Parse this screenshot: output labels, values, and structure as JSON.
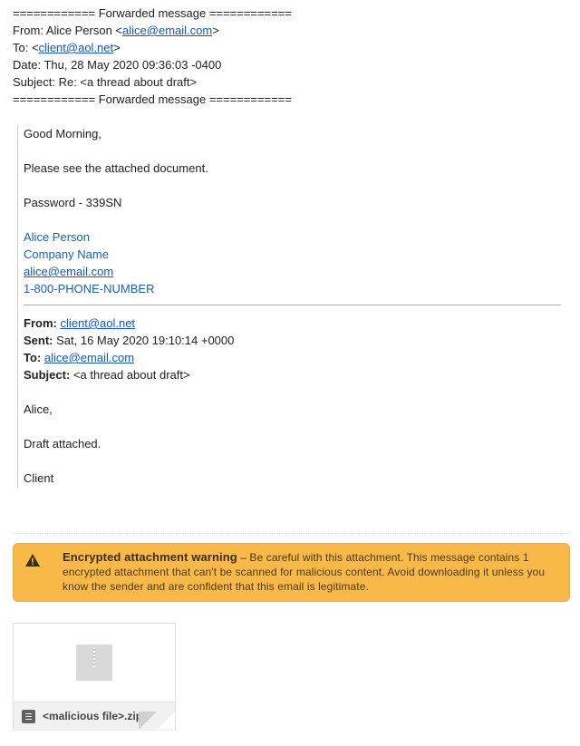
{
  "forwarded_header": {
    "separator": "============ Forwarded message ============",
    "from_prefix": "From: Alice Person <",
    "from_email": "alice@email.com",
    "from_suffix": ">",
    "to_prefix": "To: <",
    "to_email": "client@aol.net",
    "to_suffix": ">",
    "date": "Date: Thu, 28 May 2020 09:36:03 -0400",
    "subject": "Subject: Re: <a thread about draft>",
    "separator_end": "============ Forwarded message ============"
  },
  "reply": {
    "greeting": "Good Morning,",
    "body": "Please see the attached document.",
    "password": "Password - 339SN",
    "signature": {
      "name": "Alice Person",
      "company": "Company Name",
      "email": "alice@email.com",
      "phone": "1-800-PHONE-NUMBER"
    }
  },
  "original": {
    "from_label": "From:",
    "from_value": "client@aol.net",
    "sent_label": "Sent:",
    "sent_value": "Sat, 16 May 2020 19:10:14 +0000",
    "to_label": "To:",
    "to_value": "alice@email.com",
    "subject_label": "Subject:",
    "subject_value": "<a thread about draft>",
    "salutation": "Alice,",
    "body": "Draft attached.",
    "signoff": "Client"
  },
  "warning": {
    "icon": "warning-triangle-icon",
    "title": "Encrypted attachment warning",
    "message": " – Be careful with this attachment. This message contains 1 encrypted attachment that can't be scanned for malicious content. Avoid downloading it unless you know the sender and are confident that this email is legitimate.",
    "background_color": "#f9b949"
  },
  "attachment": {
    "icon": "zip-archive-icon",
    "file_type_icon": "document-icon",
    "filename": "<malicious file>.zip"
  }
}
